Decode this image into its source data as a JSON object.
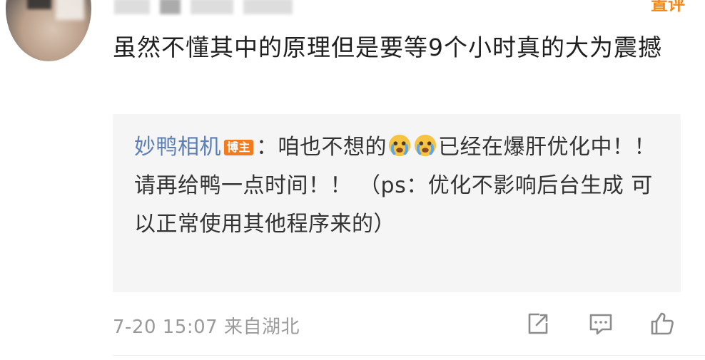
{
  "comment": {
    "text": "虽然不懂其中的原理但是要等9个小时真的大为震撼",
    "badge": "置评"
  },
  "reply": {
    "author": "妙鸭相机",
    "host_badge": "博主",
    "sep": "：咱也不想的",
    "emoji": "crying-face",
    "text_after": "已经在爆肝优化中！！ 请再给鸭一点时间！！ （ps：优化不影响后台生成 可以正常使用其他程序来的）"
  },
  "meta": {
    "date": "7-20 15:07",
    "location": "来自湖北"
  },
  "actions": {
    "share_icon": "share-icon",
    "comment_icon": "comment-icon",
    "like_icon": "like-icon"
  }
}
